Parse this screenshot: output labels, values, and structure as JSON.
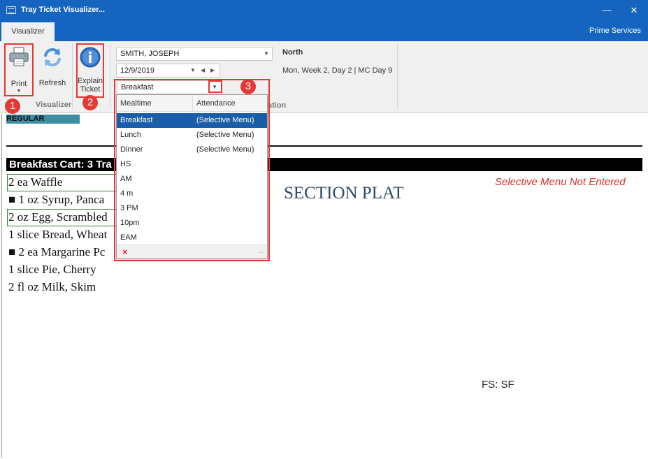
{
  "window": {
    "title": "Tray Ticket Visualizer..."
  },
  "ribbon": {
    "tab": "Visualizer",
    "right_label": "Prime Services",
    "buttons": {
      "print": "Print",
      "refresh": "Refresh",
      "explain_line1": "Explain",
      "explain_line2": "Ticket"
    },
    "group_visualizer": "Visualizer",
    "group_partial": "ation",
    "resident": "SMITH, JOSEPH",
    "date": "12/9/2019",
    "meal": "Breakfast",
    "location": "North",
    "menu_info": "Mon, Week 2, Day 2 | MC Day 9"
  },
  "annotations": [
    "1",
    "2",
    "3"
  ],
  "ticket": {
    "diet": "REGULAR",
    "cart": "Breakfast Cart: 3 Tra",
    "notice": "Selective Menu Not Entered",
    "section": "SECTION PLAT",
    "items": [
      "2 ea Waffle",
      "■ 1 oz Syrup, Panca",
      "2 oz Egg, Scrambled",
      "1 slice Bread, Wheat",
      "■ 2 ea Margarine Pc",
      "1 slice Pie, Cherry",
      "2 fl oz Milk, Skim"
    ],
    "fs": "FS: SF"
  },
  "dropdown": {
    "header": [
      "Mealtime",
      "Attendance"
    ],
    "rows": [
      {
        "meal": "Breakfast",
        "attendance": "(Selective Menu)",
        "selected": true
      },
      {
        "meal": "Lunch",
        "attendance": "(Selective Menu)"
      },
      {
        "meal": "Dinner",
        "attendance": "(Selective Menu)"
      },
      {
        "meal": "HS",
        "attendance": ""
      },
      {
        "meal": "AM",
        "attendance": ""
      },
      {
        "meal": "4 m",
        "attendance": ""
      },
      {
        "meal": "3 PM",
        "attendance": ""
      },
      {
        "meal": "10pm",
        "attendance": ""
      },
      {
        "meal": "EAM",
        "attendance": ""
      }
    ],
    "clear_glyph": "×"
  },
  "colors": {
    "titlebar": "#1565c0",
    "highlight": "#e53935",
    "selected_row": "#1a5da8",
    "diet_bar": "#3d8ea3",
    "notice": "#d32f2f"
  }
}
